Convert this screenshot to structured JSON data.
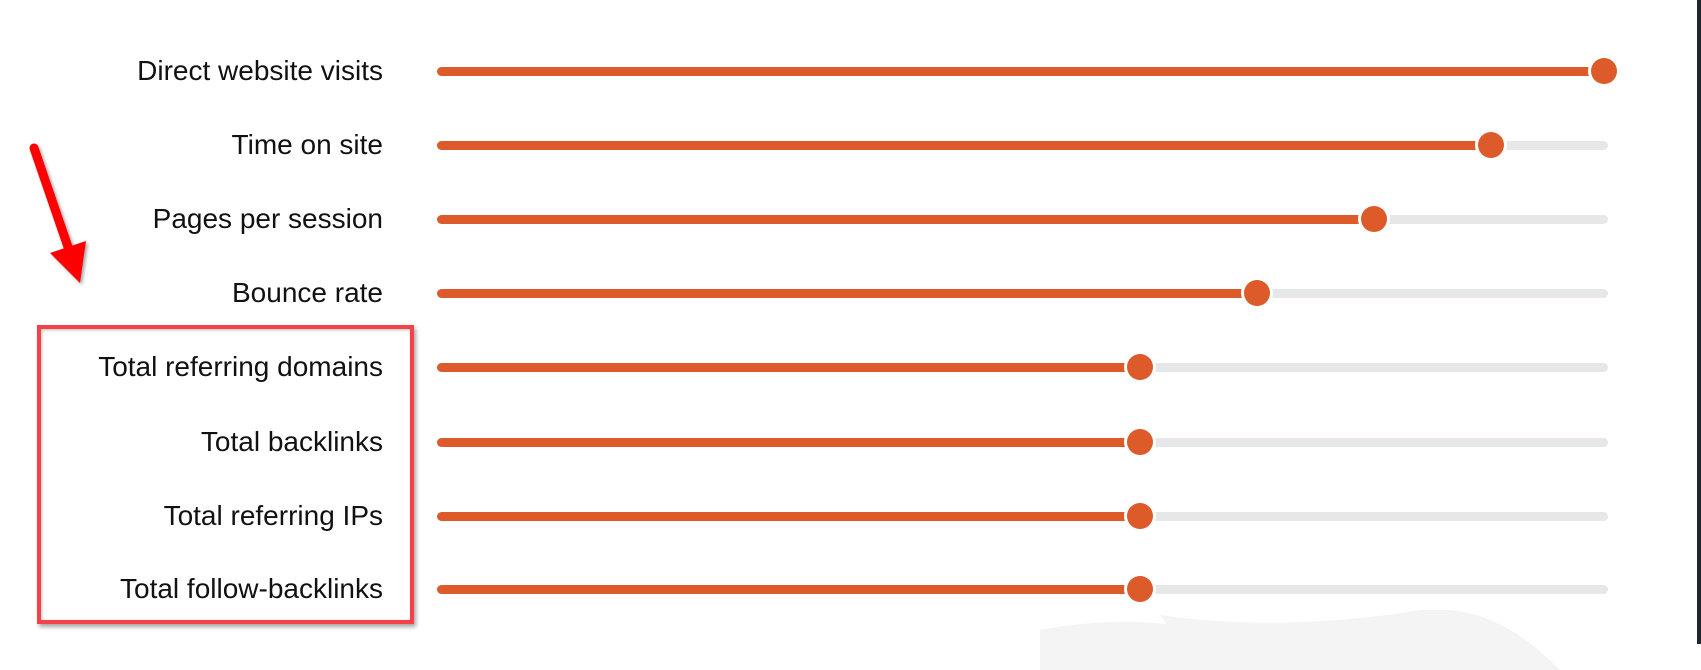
{
  "colors": {
    "accent": "#dd5b2b",
    "track": "#e6e7e9",
    "annotation": "#ff0000",
    "highlight_border": "#f5424a"
  },
  "sliders": [
    {
      "label": "Direct website visits",
      "value_percent": 100
    },
    {
      "label": "Time on site",
      "value_percent": 90
    },
    {
      "label": "Pages per session",
      "value_percent": 80
    },
    {
      "label": "Bounce rate",
      "value_percent": 70
    },
    {
      "label": "Total referring domains",
      "value_percent": 60
    },
    {
      "label": "Total backlinks",
      "value_percent": 60
    },
    {
      "label": "Total referring IPs",
      "value_percent": 60
    },
    {
      "label": "Total follow-backlinks",
      "value_percent": 60
    }
  ],
  "annotations": {
    "arrow_icon": "red-arrow-down-right",
    "highlight_box_targets": [
      "Total referring domains",
      "Total backlinks",
      "Total referring IPs",
      "Total follow-backlinks"
    ]
  }
}
